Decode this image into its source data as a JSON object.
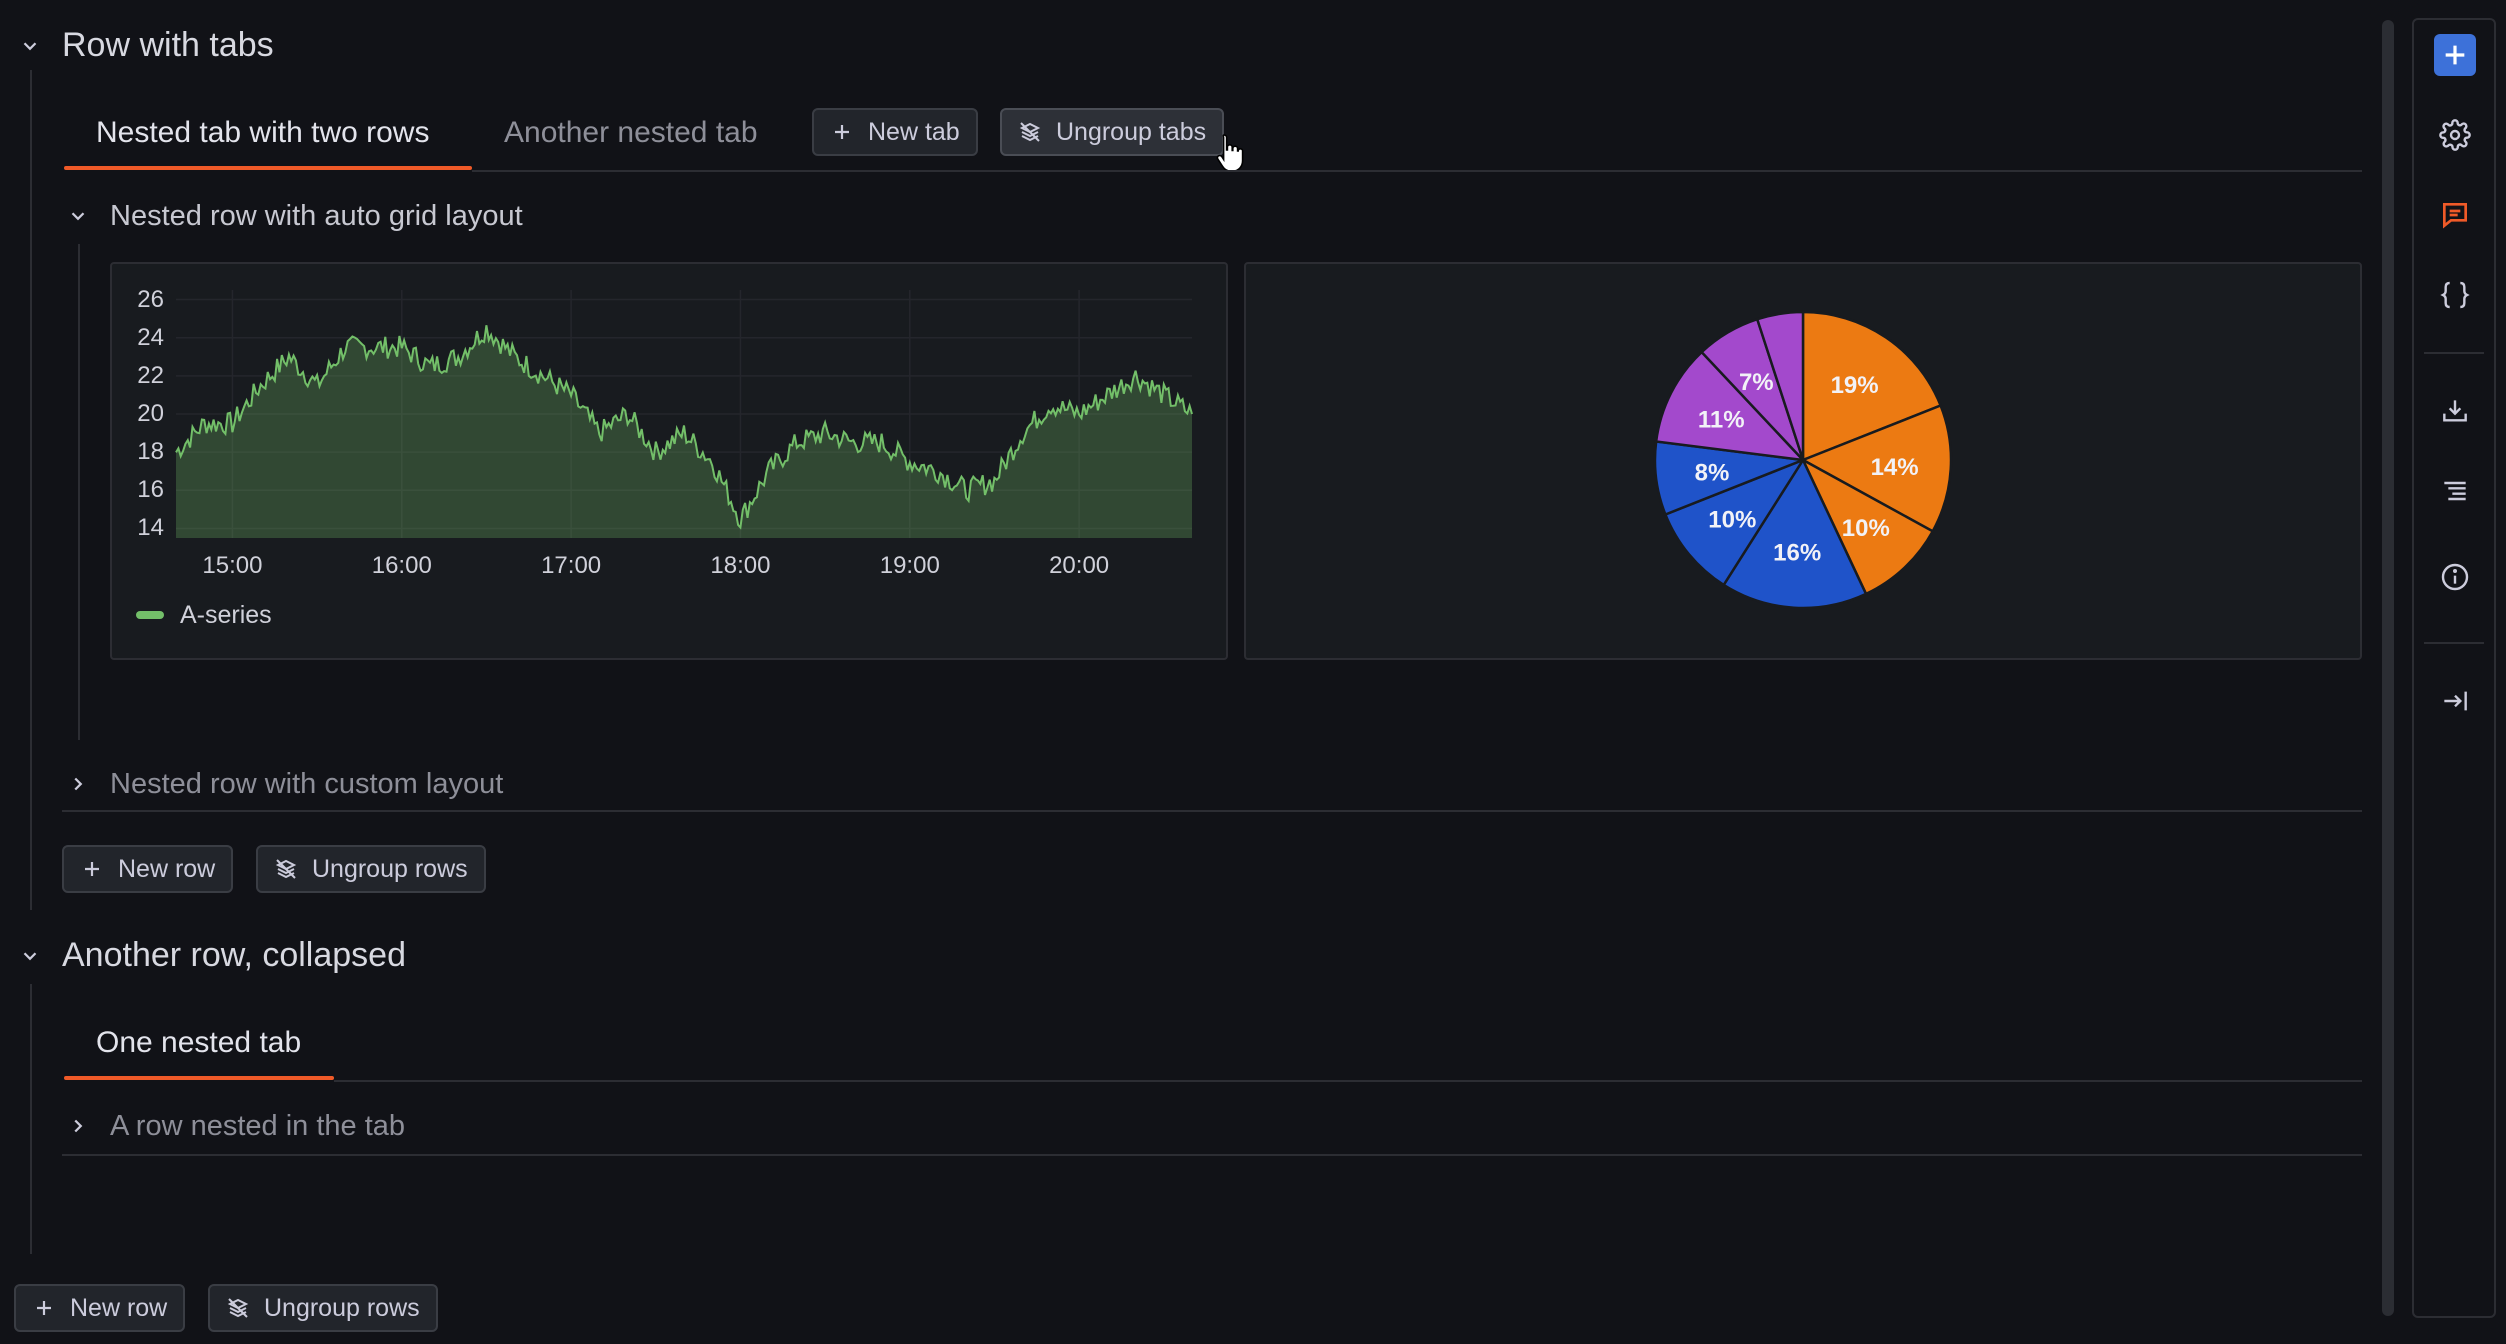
{
  "rows": [
    {
      "title": "Row with tabs",
      "tabs": [
        "Nested tab with two rows",
        "Another nested tab"
      ],
      "tab_actions": {
        "new_tab": "New tab",
        "ungroup_tabs": "Ungroup tabs"
      },
      "nested_rows": [
        "Nested row with auto grid layout",
        "Nested row with custom layout"
      ],
      "actions": {
        "new_row": "New row",
        "ungroup_rows": "Ungroup rows"
      }
    },
    {
      "title": "Another row, collapsed",
      "tabs": [
        "One nested tab"
      ],
      "nested_rows": [
        "A row nested in the tab"
      ]
    }
  ],
  "bottom_actions": {
    "new_row": "New row",
    "ungroup_rows": "Ungroup rows"
  },
  "chart_data": [
    {
      "type": "area",
      "x_ticks": [
        "15:00",
        "16:00",
        "17:00",
        "18:00",
        "19:00",
        "20:00"
      ],
      "y_ticks": [
        "26",
        "24",
        "22",
        "20",
        "18",
        "16",
        "14"
      ],
      "ylim": [
        13.5,
        26.5
      ],
      "xlim": [
        "14:40",
        "20:40"
      ],
      "grid": true,
      "legend_position": "bottom-left",
      "series": [
        {
          "name": "A-series",
          "color": "#73bf69",
          "x": [
            "14:40",
            "14:50",
            "15:00",
            "15:10",
            "15:20",
            "15:30",
            "15:40",
            "15:50",
            "16:00",
            "16:10",
            "16:20",
            "16:30",
            "16:40",
            "16:50",
            "17:00",
            "17:10",
            "17:20",
            "17:30",
            "17:40",
            "17:50",
            "18:00",
            "18:10",
            "18:20",
            "18:30",
            "18:40",
            "18:50",
            "19:00",
            "19:10",
            "19:20",
            "19:30",
            "19:40",
            "19:50",
            "20:00",
            "20:10",
            "20:20",
            "20:30",
            "20:40"
          ],
          "values": [
            18,
            19.5,
            19.5,
            21.5,
            23,
            21.5,
            23.5,
            23.5,
            23.5,
            22.5,
            23,
            24.5,
            23,
            22,
            21,
            19,
            20,
            18,
            19,
            17.5,
            14.5,
            17,
            18.5,
            19,
            18.5,
            18.5,
            17.5,
            17,
            16,
            16.5,
            19,
            20.5,
            20,
            21,
            22,
            21,
            20
          ]
        }
      ]
    },
    {
      "type": "pie",
      "slices": [
        {
          "label": "19%",
          "value": 19,
          "color": "#ec7a12"
        },
        {
          "label": "14%",
          "value": 14,
          "color": "#ec7a12"
        },
        {
          "label": "10%",
          "value": 10,
          "color": "#ec7a12"
        },
        {
          "label": "16%",
          "value": 16,
          "color": "#1f53c9"
        },
        {
          "label": "10%",
          "value": 10,
          "color": "#1f53c9"
        },
        {
          "label": "8%",
          "value": 8,
          "color": "#1f53c9"
        },
        {
          "label": "11%",
          "value": 11,
          "color": "#a349cc"
        },
        {
          "label": "7%",
          "value": 7,
          "color": "#a349cc"
        },
        {
          "label": "",
          "value": 5,
          "color": "#a349cc"
        }
      ]
    }
  ],
  "colors": {
    "accent": "#f05a28",
    "primary": "#3d71d9",
    "comment": "#f05a28"
  },
  "toolbar_icons": [
    "plus-icon",
    "gear-icon",
    "comment-icon",
    "braces-icon",
    "download-icon",
    "outline-icon",
    "info-icon",
    "collapse-sidebar-icon"
  ]
}
